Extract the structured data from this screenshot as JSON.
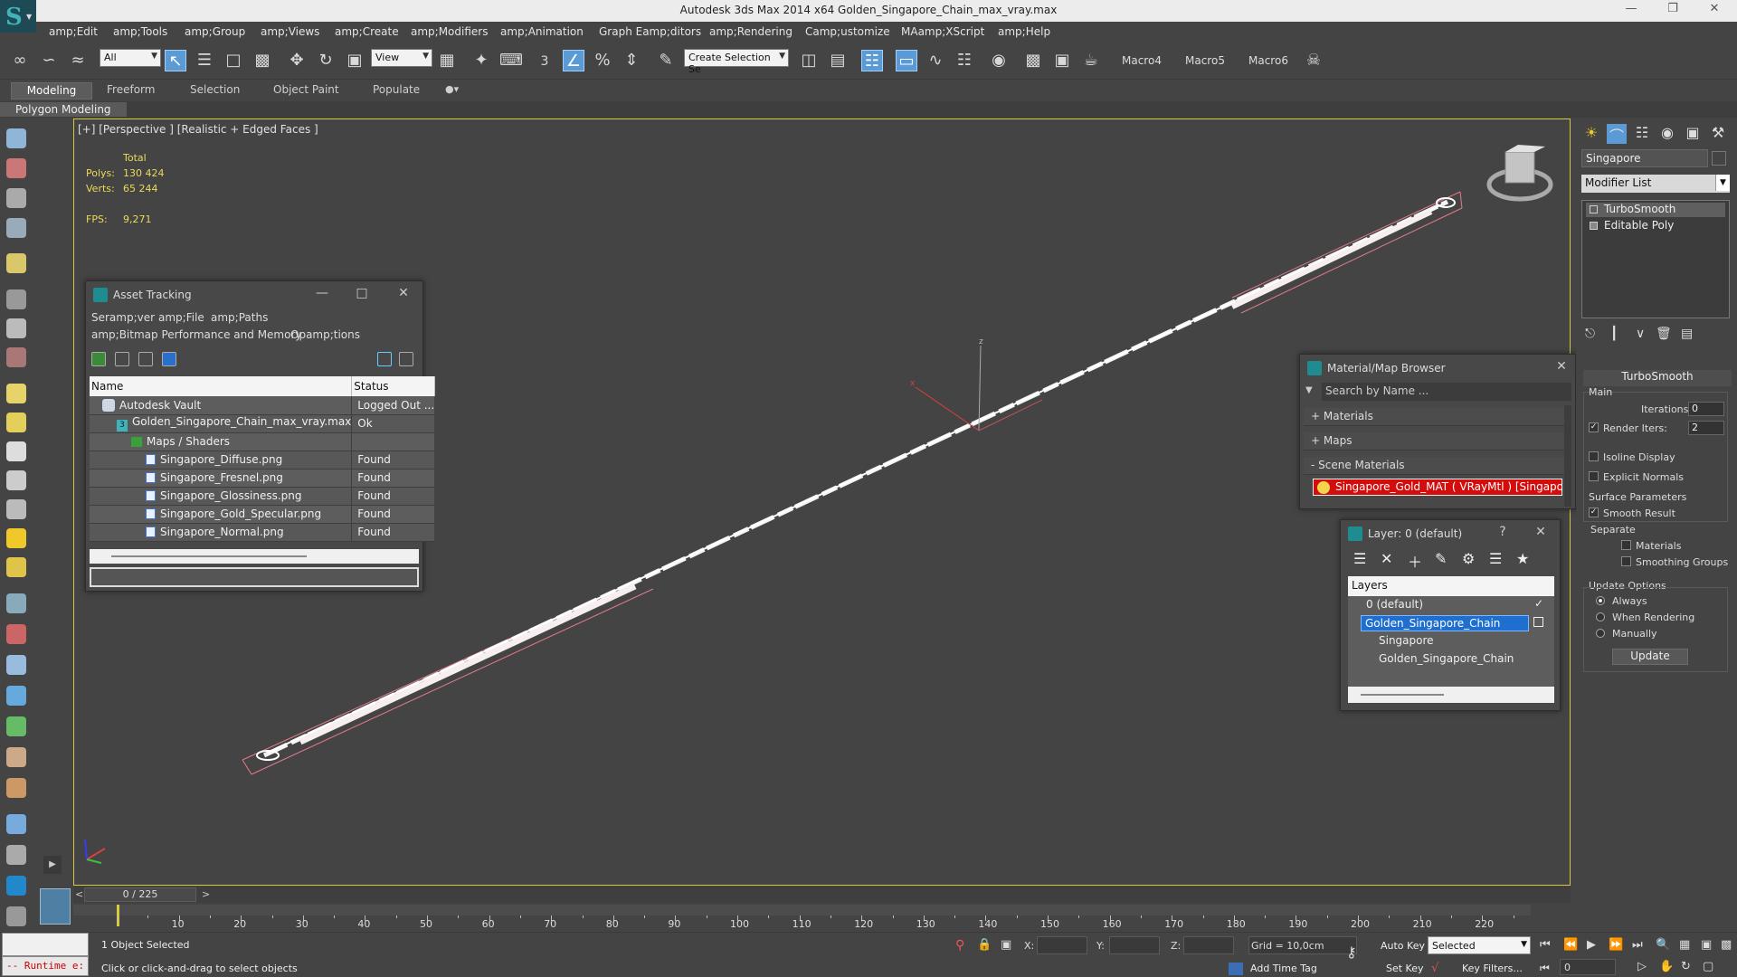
{
  "window": {
    "title": "Autodesk 3ds Max  2014 x64    Golden_Singapore_Chain_max_vray.max"
  },
  "menu": [
    "amp;Edit",
    "amp;Tools",
    "amp;Group",
    "amp;Views",
    "amp;Create",
    "amp;Modifiers",
    "amp;Animation",
    "Graph Eamp;ditors",
    "amp;Rendering",
    "Camp;ustomize",
    "MAamp;XScript",
    "amp;Help"
  ],
  "toolbar": {
    "selection_filter": "All",
    "ref_coord": "View",
    "named_selection": "Create Selection Se",
    "snap_3": "3",
    "macros": [
      "Macro4",
      "Macro5",
      "Macro6"
    ]
  },
  "ribbon": {
    "tabs": [
      "Modeling",
      "Freeform",
      "Selection",
      "Object Paint",
      "Populate"
    ],
    "sub_label": "Polygon Modeling"
  },
  "viewport": {
    "label": "[+] [Perspective ] [Realistic + Edged Faces ]",
    "stats": {
      "total_label": "Total",
      "polys_label": "Polys:",
      "polys": "130 424",
      "verts_label": "Verts:",
      "verts": "65 244",
      "fps_label": "FPS:",
      "fps": "9,271"
    },
    "gizmo": {
      "x": "x",
      "y": "y",
      "z": "z"
    }
  },
  "asset_tracking": {
    "title": "Asset Tracking",
    "menu": [
      "Seramp;ver",
      "amp;File",
      "amp;Paths",
      "amp;Bitmap Performance and Memory",
      "Opamp;tions"
    ],
    "columns": [
      "Name",
      "Status"
    ],
    "rows": [
      {
        "name": "Autodesk Vault",
        "status": "Logged Out ...",
        "type": "vault"
      },
      {
        "name": "Golden_Singapore_Chain_max_vray.max",
        "status": "Ok",
        "type": "max"
      },
      {
        "name": "Maps / Shaders",
        "status": "",
        "type": "folder"
      },
      {
        "name": "Singapore_Diffuse.png",
        "status": "Found",
        "type": "file"
      },
      {
        "name": "Singapore_Fresnel.png",
        "status": "Found",
        "type": "file"
      },
      {
        "name": "Singapore_Glossiness.png",
        "status": "Found",
        "type": "file"
      },
      {
        "name": "Singapore_Gold_Specular.png",
        "status": "Found",
        "type": "file"
      },
      {
        "name": "Singapore_Normal.png",
        "status": "Found",
        "type": "file"
      }
    ]
  },
  "material_browser": {
    "title": "Material/Map Browser",
    "search_placeholder": "Search by Name ...",
    "sections": [
      "+ Materials",
      "+ Maps",
      "- Scene Materials"
    ],
    "scene_material": "Singapore_Gold_MAT  ( VRayMtl )  [Singapore]"
  },
  "layer_window": {
    "title": "Layer: 0 (default)",
    "help": "?",
    "header": "Layers",
    "rows": [
      "0 (default)",
      "Golden_Singapore_Chain",
      "Singapore",
      "Golden_Singapore_Chain"
    ]
  },
  "command_panel": {
    "object_name": "Singapore",
    "modifier_list": "Modifier List",
    "stack": [
      "TurboSmooth",
      "Editable Poly"
    ],
    "rollout": "TurboSmooth",
    "main_label": "Main",
    "iterations_label": "Iterations:",
    "iterations": "0",
    "render_iters_label": "Render Iters:",
    "render_iters": "2",
    "isoline": "Isoline Display",
    "explicit_normals": "Explicit Normals",
    "surface_params": "Surface Parameters",
    "smooth_result": "Smooth Result",
    "separate": "Separate",
    "materials": "Materials",
    "smoothing_groups": "Smoothing Groups",
    "update_options": "Update Options",
    "always": "Always",
    "when_rendering": "When Rendering",
    "manually": "Manually",
    "update_btn": "Update"
  },
  "timeline": {
    "frame": "0 / 225",
    "ticks": [
      "10",
      "20",
      "30",
      "40",
      "50",
      "60",
      "70",
      "80",
      "90",
      "100",
      "110",
      "120",
      "130",
      "140",
      "150",
      "160",
      "170",
      "180",
      "190",
      "200",
      "210",
      "220"
    ]
  },
  "status": {
    "maxscript": "-- Runtime e:",
    "selected_msg": "1 Object Selected",
    "prompt": "Click or click-and-drag to select objects",
    "x_label": "X:",
    "y_label": "Y:",
    "z_label": "Z:",
    "grid": "Grid = 10,0cm",
    "add_time_tag": "Add Time Tag",
    "auto_key": "Auto Key",
    "set_key": "Set Key",
    "selected": "Selected",
    "key_filters": "Key Filters...",
    "frame_value": "0"
  },
  "colors": {
    "accent": "#5b9bd5",
    "viewport_border": "#d6c642",
    "stats": "#ecd95a",
    "scene_material": "#d30c0c",
    "selection": "#1f6fd0"
  }
}
